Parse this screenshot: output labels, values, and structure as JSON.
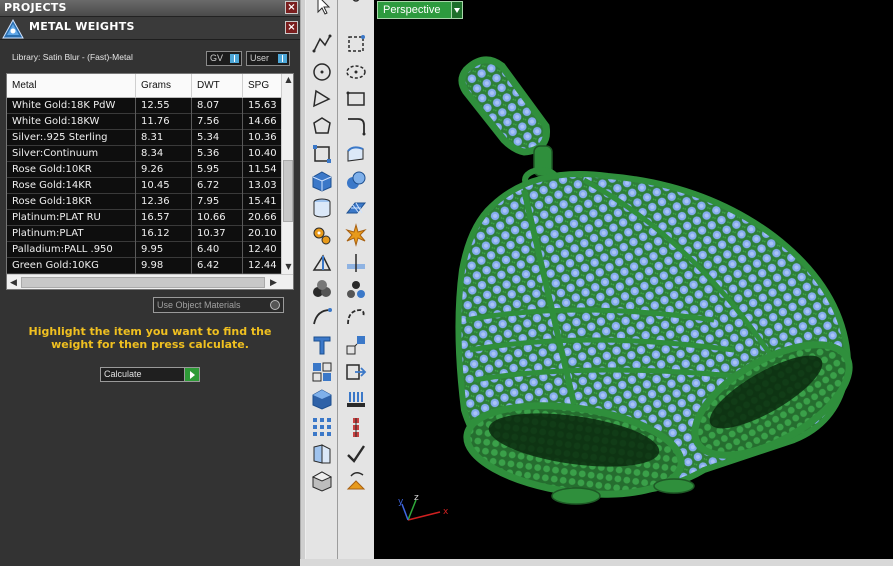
{
  "projects_panel": {
    "title": "PROJECTS"
  },
  "metal_weights": {
    "title": "METAL WEIGHTS",
    "library_label": "Library: Satin Blur - (Fast)-Metal",
    "gv_label": "GV",
    "user_label": "User",
    "columns": [
      "Metal",
      "Grams",
      "DWT",
      "SPG"
    ],
    "rows": [
      [
        "White Gold:18K PdW",
        "12.55",
        "8.07",
        "15.63"
      ],
      [
        "White Gold:18KW",
        "11.76",
        "7.56",
        "14.66"
      ],
      [
        "Silver:.925 Sterling",
        "8.31",
        "5.34",
        "10.36"
      ],
      [
        "Silver:Continuum",
        "8.34",
        "5.36",
        "10.40"
      ],
      [
        "Rose Gold:10KR",
        "9.26",
        "5.95",
        "11.54"
      ],
      [
        "Rose Gold:14KR",
        "10.45",
        "6.72",
        "13.03"
      ],
      [
        "Rose Gold:18KR",
        "12.36",
        "7.95",
        "15.41"
      ],
      [
        "Platinum:PLAT RU",
        "16.57",
        "10.66",
        "20.66"
      ],
      [
        "Platinum:PLAT",
        "16.12",
        "10.37",
        "20.10"
      ],
      [
        "Palladium:PALL .950",
        "9.95",
        "6.40",
        "12.40"
      ],
      [
        "Green Gold:10KG",
        "9.98",
        "6.42",
        "12.44"
      ]
    ],
    "use_object_materials_label": "Use Object Materials",
    "hint_text": "Highlight the item you want to find the weight for then press calculate.",
    "calculate_label": "Calculate"
  },
  "viewport": {
    "view_label": "Perspective",
    "axis_labels": {
      "x": "x",
      "y": "y",
      "z": "z"
    }
  },
  "toolbar_left_icons": [
    "pointer-icon",
    "polyline-icon",
    "circle-icon",
    "triangle-curve-icon",
    "polygon-icon",
    "edit-points-icon",
    "cube-icon",
    "cylinder-icon",
    "gears-icon",
    "draft-angle-icon",
    "spheres-icon",
    "curve-arc-icon",
    "text-t-icon",
    "boxes-icon",
    "box-solid-icon",
    "grid-array-icon",
    "book-panel-icon",
    "cube-shadow-icon"
  ],
  "toolbar_right_icons": [
    "node-icon",
    "dashed-square-icon",
    "ellipse-dashed-icon",
    "rectangle-icon",
    "fillet-curve-icon",
    "bend-shape-icon",
    "boolean-spheres-icon",
    "surface-grid-icon",
    "starburst-icon",
    "cut-plane-icon",
    "gem-cluster-icon",
    "spiral-curve-icon",
    "resize-diagonal-icon",
    "arrow-rect-icon",
    "prongs-icon",
    "column-stack-icon",
    "checkmark-icon",
    "flow-curve-icon"
  ],
  "colors": {
    "accent_green": "#2d9a3e",
    "hint_yellow": "#f0c020",
    "model_green": "#2f8f3c",
    "gem_blue": "#7fa9f0"
  }
}
